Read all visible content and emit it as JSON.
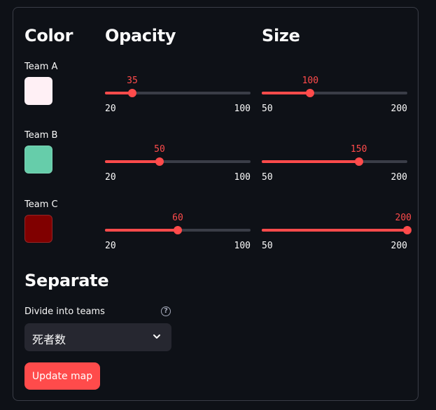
{
  "headers": {
    "color": "Color",
    "opacity": "Opacity",
    "size": "Size"
  },
  "teams": [
    {
      "label": "Team A",
      "color": "#fff0f5",
      "opacity": {
        "value": "35",
        "min": "20",
        "max": "100",
        "fraction": 0.1875
      },
      "size": {
        "value": "100",
        "min": "50",
        "max": "200",
        "fraction": 0.3333
      }
    },
    {
      "label": "Team B",
      "color": "#66cdaa",
      "opacity": {
        "value": "50",
        "min": "20",
        "max": "100",
        "fraction": 0.375
      },
      "size": {
        "value": "150",
        "min": "50",
        "max": "200",
        "fraction": 0.6667
      }
    },
    {
      "label": "Team C",
      "color": "#800000",
      "opacity": {
        "value": "60",
        "min": "20",
        "max": "100",
        "fraction": 0.5
      },
      "size": {
        "value": "200",
        "min": "50",
        "max": "200",
        "fraction": 1.0
      }
    }
  ],
  "separate": {
    "title": "Separate",
    "field_label": "Divide into teams",
    "help_icon": "question-circle-icon",
    "selected": "死者数",
    "chevron_icon": "chevron-down-icon"
  },
  "update_button": {
    "label": "Update map"
  },
  "colors": {
    "accent": "#ff4b4b",
    "background": "#0e1117",
    "track": "#3a3d47",
    "select_bg": "#262730"
  }
}
